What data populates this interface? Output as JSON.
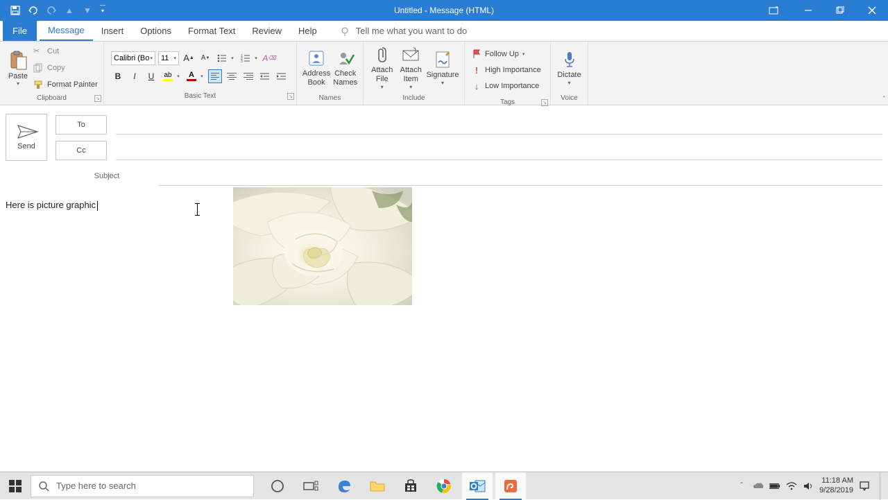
{
  "title": "Untitled  -  Message (HTML)",
  "ribbon_tabs": {
    "file": "File",
    "message": "Message",
    "insert": "Insert",
    "options": "Options",
    "format_text": "Format Text",
    "review": "Review",
    "help": "Help",
    "tell_me": "Tell me what you want to do"
  },
  "clipboard": {
    "paste": "Paste",
    "cut": "Cut",
    "copy": "Copy",
    "format_painter": "Format Painter",
    "group": "Clipboard"
  },
  "basic_text": {
    "font_name": "Calibri (Bo",
    "font_size": "11",
    "group": "Basic Text"
  },
  "names": {
    "address_book": "Address\nBook",
    "check_names": "Check\nNames",
    "group": "Names"
  },
  "include": {
    "attach_file": "Attach\nFile",
    "attach_item": "Attach\nItem",
    "signature": "Signature",
    "group": "Include"
  },
  "tags": {
    "follow_up": "Follow Up",
    "high": "High Importance",
    "low": "Low Importance",
    "group": "Tags"
  },
  "voice": {
    "dictate": "Dictate",
    "group": "Voice"
  },
  "compose": {
    "send": "Send",
    "to": "To",
    "cc": "Cc",
    "subject": "Subject",
    "body_text": "Here is picture graphic"
  },
  "taskbar": {
    "search_placeholder": "Type here to search",
    "time": "11:18 AM",
    "date": "9/28/2019"
  }
}
